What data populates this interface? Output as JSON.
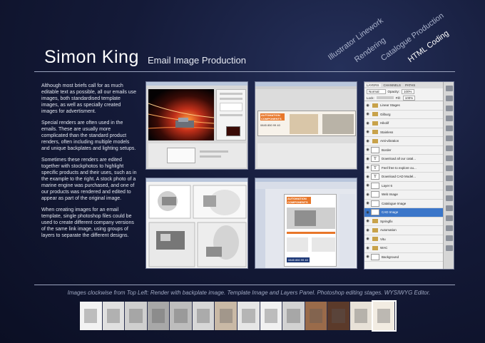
{
  "header": {
    "name": "Simon King",
    "section": "Email Image Production"
  },
  "nav": {
    "items": [
      {
        "label": "Illustrator Linework",
        "active": false
      },
      {
        "label": "Rendering",
        "active": false
      },
      {
        "label": "Catalogue Production",
        "active": false
      },
      {
        "label": "HTML Coding",
        "active": true
      }
    ]
  },
  "body": {
    "paragraphs": [
      "Although most briefs call for as much editable text as possible, all our emails use images, both standardised template images, as well as specially created images for advertisment.",
      "Special renders are often used in the emails. These are usually more complicated than the standard product renders, often including multiple models and unique backplates and lighting setups.",
      "Sometimes these renders are edited together with stockphotos to highlight specific products and their uses, such as in the example to the right. A stock photo of a marine engine was purchased, and one of our products was rendered and edited to appear as part of the original image.",
      "When creating images for an email template, single photoshop files could be used to create different company versions of the same link image, using groups of layers to separate the different designs."
    ]
  },
  "screenshots": {
    "template": {
      "logo_line1": "AUTOMATION",
      "logo_line2": "COMPONENTS",
      "phone": "0845 850 99 40"
    },
    "wysiwyg": {
      "logo_line1": "AUTOMATION",
      "logo_line2": "COMPONENTS",
      "phone": "0845 850 99 40"
    },
    "layers_panel": {
      "tabs": [
        "LAYERS",
        "CHANNELS",
        "PATHS"
      ],
      "blend_mode": "Normal",
      "opacity_label": "Opacity:",
      "opacity": "100%",
      "lock_label": "Lock:",
      "fill_label": "Fill:",
      "fill": "100%",
      "layers": [
        {
          "name": "Linear Stages",
          "kind": "folder",
          "selected": false
        },
        {
          "name": "Gilburg",
          "kind": "folder",
          "selected": false
        },
        {
          "name": "Hikolif",
          "kind": "folder",
          "selected": false
        },
        {
          "name": "Stainless",
          "kind": "folder",
          "selected": false
        },
        {
          "name": "Anti-vibration",
          "kind": "folder",
          "selected": false
        },
        {
          "name": "Border",
          "kind": "image",
          "selected": false
        },
        {
          "name": "Download all our catal...",
          "kind": "text",
          "selected": false
        },
        {
          "name": "Feel free to explore ou...",
          "kind": "text",
          "selected": false
        },
        {
          "name": "Download CAD Model...",
          "kind": "text",
          "selected": false
        },
        {
          "name": "Layer 6",
          "kind": "image",
          "selected": false
        },
        {
          "name": "Web Image",
          "kind": "image",
          "selected": false
        },
        {
          "name": "Catalogue Image",
          "kind": "image",
          "selected": false
        },
        {
          "name": "CAD Image",
          "kind": "image",
          "selected": true
        },
        {
          "name": "Springfix",
          "kind": "folder",
          "selected": false
        },
        {
          "name": "Automation",
          "kind": "folder",
          "selected": false
        },
        {
          "name": "Vitu",
          "kind": "folder",
          "selected": false
        },
        {
          "name": "WAC",
          "kind": "folder",
          "selected": false
        },
        {
          "name": "Background",
          "kind": "image",
          "selected": false
        }
      ]
    }
  },
  "caption": "Images clockwise from Top Left: Render with backplate image. Template Image and Layers Panel. Photoshop editing stages. WYSIWYG Editor.",
  "thumbnails": {
    "count": 14,
    "selected_index": 13
  },
  "colors": {
    "background": "#141a38",
    "rule": "#9aa3bd",
    "accent_orange": "#e8772a",
    "selection_blue": "#3b76c9"
  }
}
